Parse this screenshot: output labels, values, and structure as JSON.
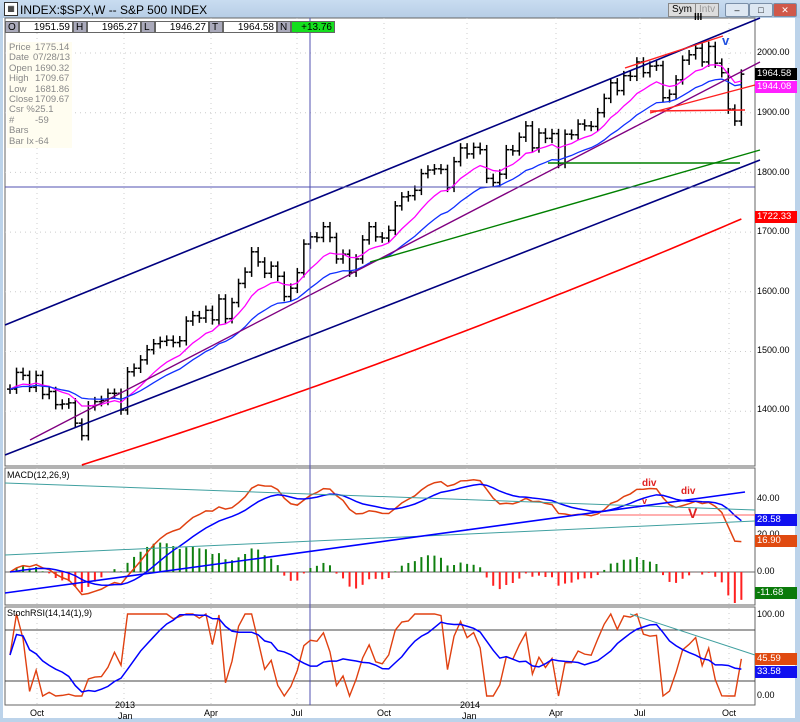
{
  "window": {
    "title": "INDEX:$SPX,W -- S&P 500 INDEX",
    "sym_button": "Sym",
    "intv_button": "Intv",
    "minimize": "–",
    "restore": "□",
    "close": "✕"
  },
  "quote": {
    "o_label": "O",
    "o": "1951.59",
    "h_label": "H",
    "h": "1965.27",
    "l_label": "L",
    "l": "1946.27",
    "t_label": "T",
    "t": "1964.58",
    "n_label": "N",
    "n": "+13.76"
  },
  "info": [
    {
      "k": "Price",
      "v": "1775.14"
    },
    {
      "k": "Date",
      "v": "07/28/13"
    },
    {
      "k": "Open",
      "v": "1690.32"
    },
    {
      "k": "High",
      "v": "1709.67"
    },
    {
      "k": "Low",
      "v": "1681.86"
    },
    {
      "k": "Close",
      "v": "1709.67"
    },
    {
      "k": "Csr %",
      "v": "25.1"
    },
    {
      "k": "# Bars",
      "v": "-59"
    },
    {
      "k": "Bar Ix",
      "v": "-64"
    }
  ],
  "chart_data": {
    "type": "ohlc-weekly",
    "title": "INDEX:$SPX,W -- S&P 500 INDEX",
    "price_axis": {
      "ticks": [
        "2000.00",
        "1900.00",
        "1800.00",
        "1700.00",
        "1600.00",
        "1500.00",
        "1400.00"
      ],
      "range": [
        1250,
        2080
      ]
    },
    "x_ticks": [
      {
        "label": "Oct",
        "year": ""
      },
      {
        "label": "Jan",
        "year": "2013"
      },
      {
        "label": "Apr",
        "year": ""
      },
      {
        "label": "Jul",
        "year": ""
      },
      {
        "label": "Oct",
        "year": ""
      },
      {
        "label": "Jan",
        "year": "2014"
      },
      {
        "label": "Apr",
        "year": ""
      },
      {
        "label": "Jul",
        "year": ""
      },
      {
        "label": "Oct",
        "year": ""
      }
    ],
    "closes": [
      1437,
      1465,
      1460,
      1440,
      1460,
      1428,
      1433,
      1411,
      1412,
      1414,
      1380,
      1359,
      1409,
      1416,
      1418,
      1430,
      1430,
      1402,
      1466,
      1472,
      1486,
      1503,
      1513,
      1517,
      1519,
      1515,
      1518,
      1551,
      1560,
      1556,
      1569,
      1553,
      1588,
      1555,
      1582,
      1614,
      1633,
      1667,
      1650,
      1631,
      1643,
      1626,
      1592,
      1606,
      1632,
      1680,
      1692,
      1691,
      1709,
      1691,
      1655,
      1663,
      1633,
      1655,
      1687,
      1709,
      1692,
      1690,
      1703,
      1744,
      1759,
      1761,
      1770,
      1798,
      1804,
      1806,
      1805,
      1775,
      1818,
      1841,
      1831,
      1842,
      1838,
      1790,
      1783,
      1797,
      1838,
      1836,
      1859,
      1878,
      1841,
      1866,
      1857,
      1865,
      1815,
      1864,
      1863,
      1881,
      1878,
      1877,
      1900,
      1924,
      1950,
      1937,
      1962,
      1961,
      1985,
      1967,
      1978,
      1979,
      1925,
      1931,
      1955,
      1988,
      1997,
      2008,
      1985,
      2011,
      1983,
      1967,
      1906,
      1886,
      1964.58
    ],
    "last_values": {
      "close": "1964.58",
      "ema_short": "1944.08",
      "ma_long": "1722.33"
    },
    "macd": {
      "label": "MACD(12,26,9)",
      "ticks": [
        "40.00",
        "20.00",
        "0.00"
      ],
      "values": {
        "macd": "16.90",
        "signal": "28.58",
        "histogram": "-11.68"
      }
    },
    "stochrsi": {
      "label": "StochRSI(14,14(1),9)",
      "ticks": [
        "100.00",
        "0.00"
      ],
      "values": {
        "stoch": "45.59",
        "signal": "33.58"
      }
    },
    "annotations": [
      "III",
      "v",
      "div",
      "div",
      "v",
      "V"
    ],
    "colors": {
      "bars": "#000000",
      "ema_short": "#ff00ff",
      "ema_mid": "#0000ff",
      "ma_long": "#ff0000",
      "channel": "#000080",
      "macd_line": "#e04010",
      "signal_line": "#0000ff"
    }
  }
}
